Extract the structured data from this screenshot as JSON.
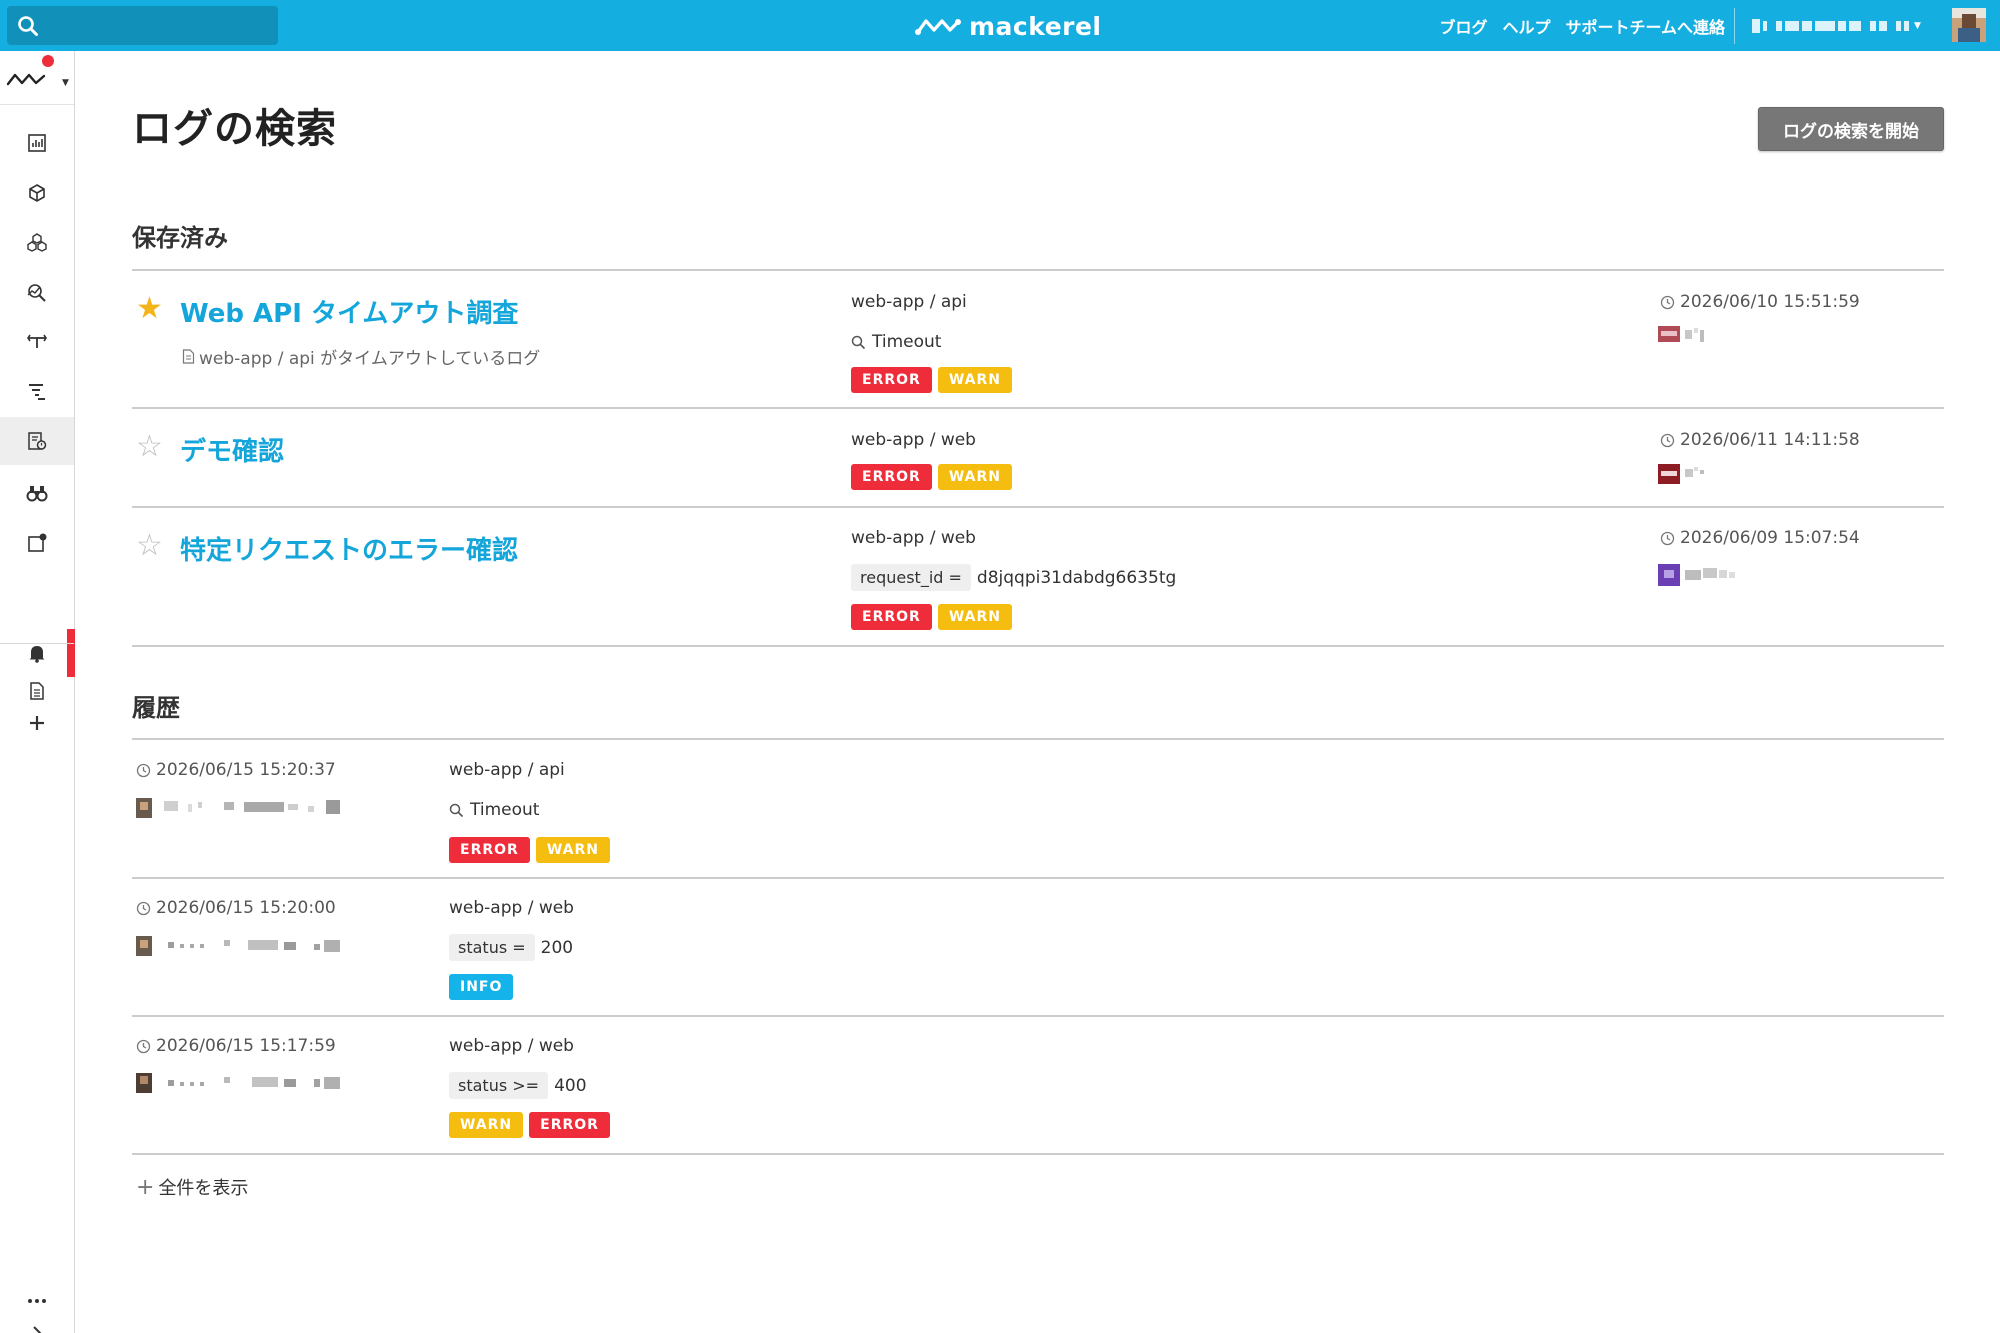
{
  "topbar": {
    "brand": "mackerel",
    "links": [
      "ブログ",
      "ヘルプ",
      "サポートチームへ連絡"
    ]
  },
  "page": {
    "title": "ログの検索",
    "start_button": "ログの検索を開始"
  },
  "saved": {
    "heading": "保存済み",
    "items": [
      {
        "title": "Web API タイムアウト調査",
        "starred": true,
        "description": "web-app / api がタイムアウトしているログ",
        "source": "web-app / api",
        "query": "Timeout",
        "levels": [
          "ERROR",
          "WARN"
        ],
        "timestamp": "2026/06/10 15:51:59"
      },
      {
        "title": "デモ確認",
        "starred": false,
        "source": "web-app / web",
        "levels": [
          "ERROR",
          "WARN"
        ],
        "timestamp": "2026/06/11 14:11:58"
      },
      {
        "title": "特定リクエストのエラー確認",
        "starred": false,
        "source": "web-app / web",
        "filter": {
          "key": "request_id =",
          "value": "d8jqqpi31dabdg6635tg"
        },
        "levels": [
          "ERROR",
          "WARN"
        ],
        "timestamp": "2026/06/09 15:07:54"
      }
    ]
  },
  "history": {
    "heading": "履歴",
    "items": [
      {
        "timestamp": "2026/06/15 15:20:37",
        "source": "web-app / api",
        "query": "Timeout",
        "levels": [
          "ERROR",
          "WARN"
        ]
      },
      {
        "timestamp": "2026/06/15 15:20:00",
        "source": "web-app / web",
        "filter": {
          "key": "status =",
          "value": "200"
        },
        "levels": [
          "INFO"
        ]
      },
      {
        "timestamp": "2026/06/15 15:17:59",
        "source": "web-app / web",
        "filter": {
          "key": "status >=",
          "value": "400"
        },
        "levels": [
          "WARN",
          "ERROR"
        ]
      }
    ],
    "show_all": "全件を表示"
  },
  "colors": {
    "brand": "#15aee1",
    "link": "#14a6db",
    "error": "#ef2d3a",
    "warn": "#f4bd0f",
    "info": "#14b4ea",
    "star": "#f3b51b"
  },
  "sidebar": {
    "icons": [
      "overview-icon",
      "hosts-icon",
      "services-icon",
      "anomaly-icon",
      "tracing-icon",
      "trace-list-icon",
      "log-search-icon",
      "monitors-icon",
      "dashboards-icon",
      "alerts-icon",
      "document-icon",
      "add-icon",
      "more-icon",
      "expand-icon"
    ]
  }
}
